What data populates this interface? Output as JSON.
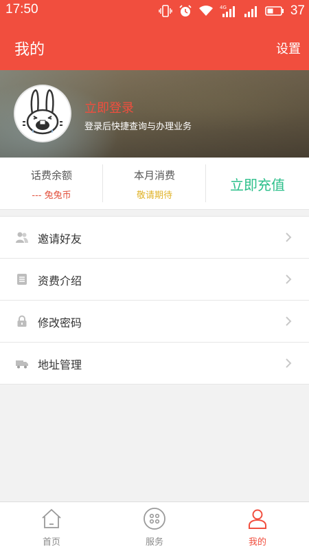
{
  "status_bar": {
    "time": "17:50",
    "battery": "37"
  },
  "header": {
    "title": "我的",
    "settings": "设置"
  },
  "profile": {
    "login_title": "立即登录",
    "login_subtitle": "登录后快捷查询与办理业务"
  },
  "stats": {
    "balance": {
      "label": "话费余额",
      "value": "--- 兔兔币"
    },
    "monthly": {
      "label": "本月消费",
      "value": "敬请期待"
    },
    "recharge": {
      "label": "立即充值"
    }
  },
  "menu": [
    {
      "label": "邀请好友",
      "icon": "people-icon"
    },
    {
      "label": "资费介绍",
      "icon": "document-icon"
    },
    {
      "label": "修改密码",
      "icon": "lock-icon"
    },
    {
      "label": "地址管理",
      "icon": "truck-icon"
    }
  ],
  "tabs": [
    {
      "label": "首页",
      "icon": "home-icon",
      "active": false
    },
    {
      "label": "服务",
      "icon": "grid-icon",
      "active": false
    },
    {
      "label": "我的",
      "icon": "person-icon",
      "active": true
    }
  ],
  "colors": {
    "brand": "#f14e3e",
    "recharge": "#2bbf8a",
    "balance_value": "#e2503c",
    "monthly_value": "#e0b329"
  }
}
